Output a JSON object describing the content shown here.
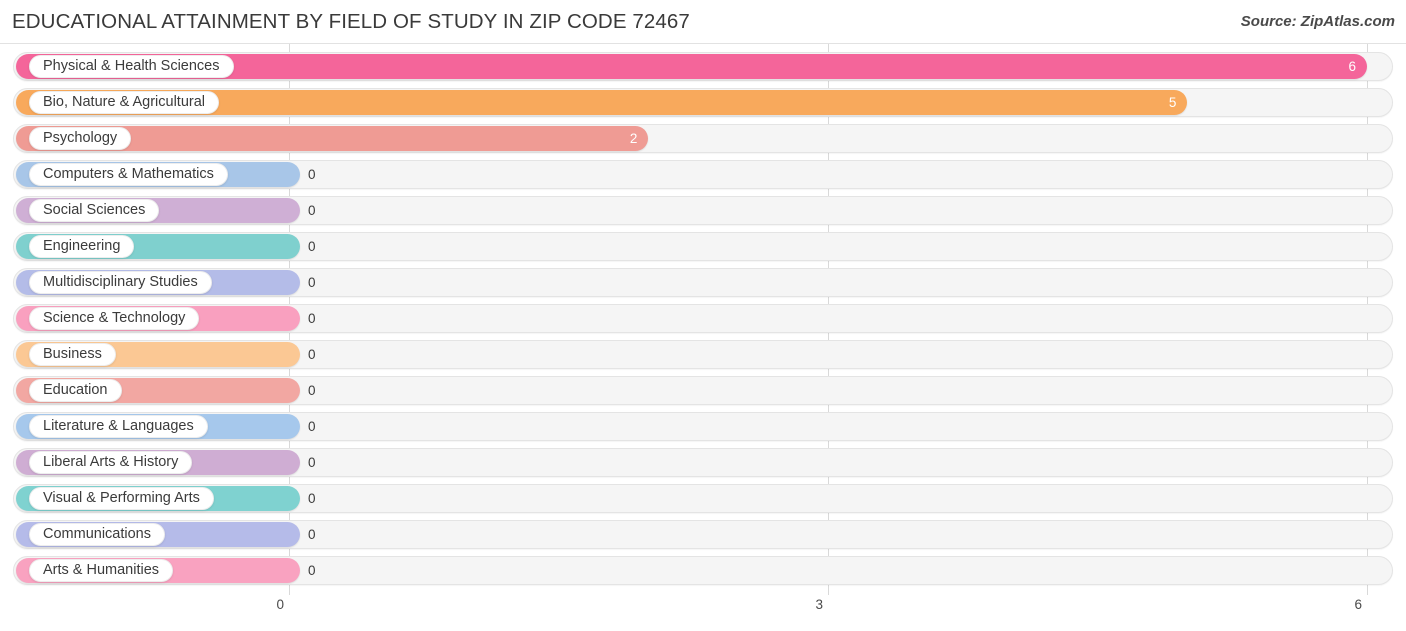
{
  "header": {
    "title": "EDUCATIONAL ATTAINMENT BY FIELD OF STUDY IN ZIP CODE 72467",
    "source": "Source: ZipAtlas.com"
  },
  "chart_data": {
    "type": "bar",
    "orientation": "horizontal",
    "title": "EDUCATIONAL ATTAINMENT BY FIELD OF STUDY IN ZIP CODE 72467",
    "xlabel": "",
    "ylabel": "",
    "xlim": [
      0,
      6
    ],
    "ticks": [
      "0",
      "3",
      "6"
    ],
    "tick_values": [
      0,
      3,
      6
    ],
    "grid": true,
    "legend": "none",
    "categories": [
      "Physical & Health Sciences",
      "Bio, Nature & Agricultural",
      "Psychology",
      "Computers & Mathematics",
      "Social Sciences",
      "Engineering",
      "Multidisciplinary Studies",
      "Science & Technology",
      "Business",
      "Education",
      "Literature & Languages",
      "Liberal Arts & History",
      "Visual & Performing Arts",
      "Communications",
      "Arts & Humanities"
    ],
    "values": [
      6,
      5,
      2,
      0,
      0,
      0,
      0,
      0,
      0,
      0,
      0,
      0,
      0,
      0,
      0
    ],
    "value_labels": [
      "6",
      "5",
      "2",
      "0",
      "0",
      "0",
      "0",
      "0",
      "0",
      "0",
      "0",
      "0",
      "0",
      "0",
      "0"
    ],
    "colors": [
      "#f4659a",
      "#f8a95c",
      "#ef9b94",
      "#a8c6e8",
      "#cfafd5",
      "#7fd0ce",
      "#b4bce8",
      "#f9a0bf",
      "#fbc894",
      "#f2a7a2",
      "#a6c8ec",
      "#cfadd3",
      "#7fd2d0",
      "#b5bbe9",
      "#f9a2c0"
    ]
  },
  "rows": [
    {
      "label": "Physical & Health Sciences",
      "value": 6,
      "value_label": "6",
      "color": "#f4659a",
      "min_width": 0
    },
    {
      "label": "Bio, Nature & Agricultural",
      "value": 5,
      "value_label": "5",
      "color": "#f8a95c",
      "min_width": 0
    },
    {
      "label": "Psychology",
      "value": 2,
      "value_label": "2",
      "color": "#ef9b94",
      "min_width": 0
    },
    {
      "label": "Computers & Mathematics",
      "value": 0,
      "value_label": "0",
      "color": "#a8c6e8",
      "min_width": 284
    },
    {
      "label": "Social Sciences",
      "value": 0,
      "value_label": "0",
      "color": "#cfafd5",
      "min_width": 284
    },
    {
      "label": "Engineering",
      "value": 0,
      "value_label": "0",
      "color": "#7fd0ce",
      "min_width": 284
    },
    {
      "label": "Multidisciplinary Studies",
      "value": 0,
      "value_label": "0",
      "color": "#b4bce8",
      "min_width": 284
    },
    {
      "label": "Science & Technology",
      "value": 0,
      "value_label": "0",
      "color": "#f9a0bf",
      "min_width": 284
    },
    {
      "label": "Business",
      "value": 0,
      "value_label": "0",
      "color": "#fbc894",
      "min_width": 284
    },
    {
      "label": "Education",
      "value": 0,
      "value_label": "0",
      "color": "#f2a7a2",
      "min_width": 284
    },
    {
      "label": "Literature & Languages",
      "value": 0,
      "value_label": "0",
      "color": "#a6c8ec",
      "min_width": 284
    },
    {
      "label": "Liberal Arts & History",
      "value": 0,
      "value_label": "0",
      "color": "#cfadd3",
      "min_width": 284
    },
    {
      "label": "Visual & Performing Arts",
      "value": 0,
      "value_label": "0",
      "color": "#7fd2d0",
      "min_width": 284
    },
    {
      "label": "Communications",
      "value": 0,
      "value_label": "0",
      "color": "#b5bbe9",
      "min_width": 284
    },
    {
      "label": "Arts & Humanities",
      "value": 0,
      "value_label": "0",
      "color": "#f9a2c0",
      "min_width": 284
    }
  ],
  "axis": {
    "ticks": [
      "0",
      "3",
      "6"
    ]
  }
}
